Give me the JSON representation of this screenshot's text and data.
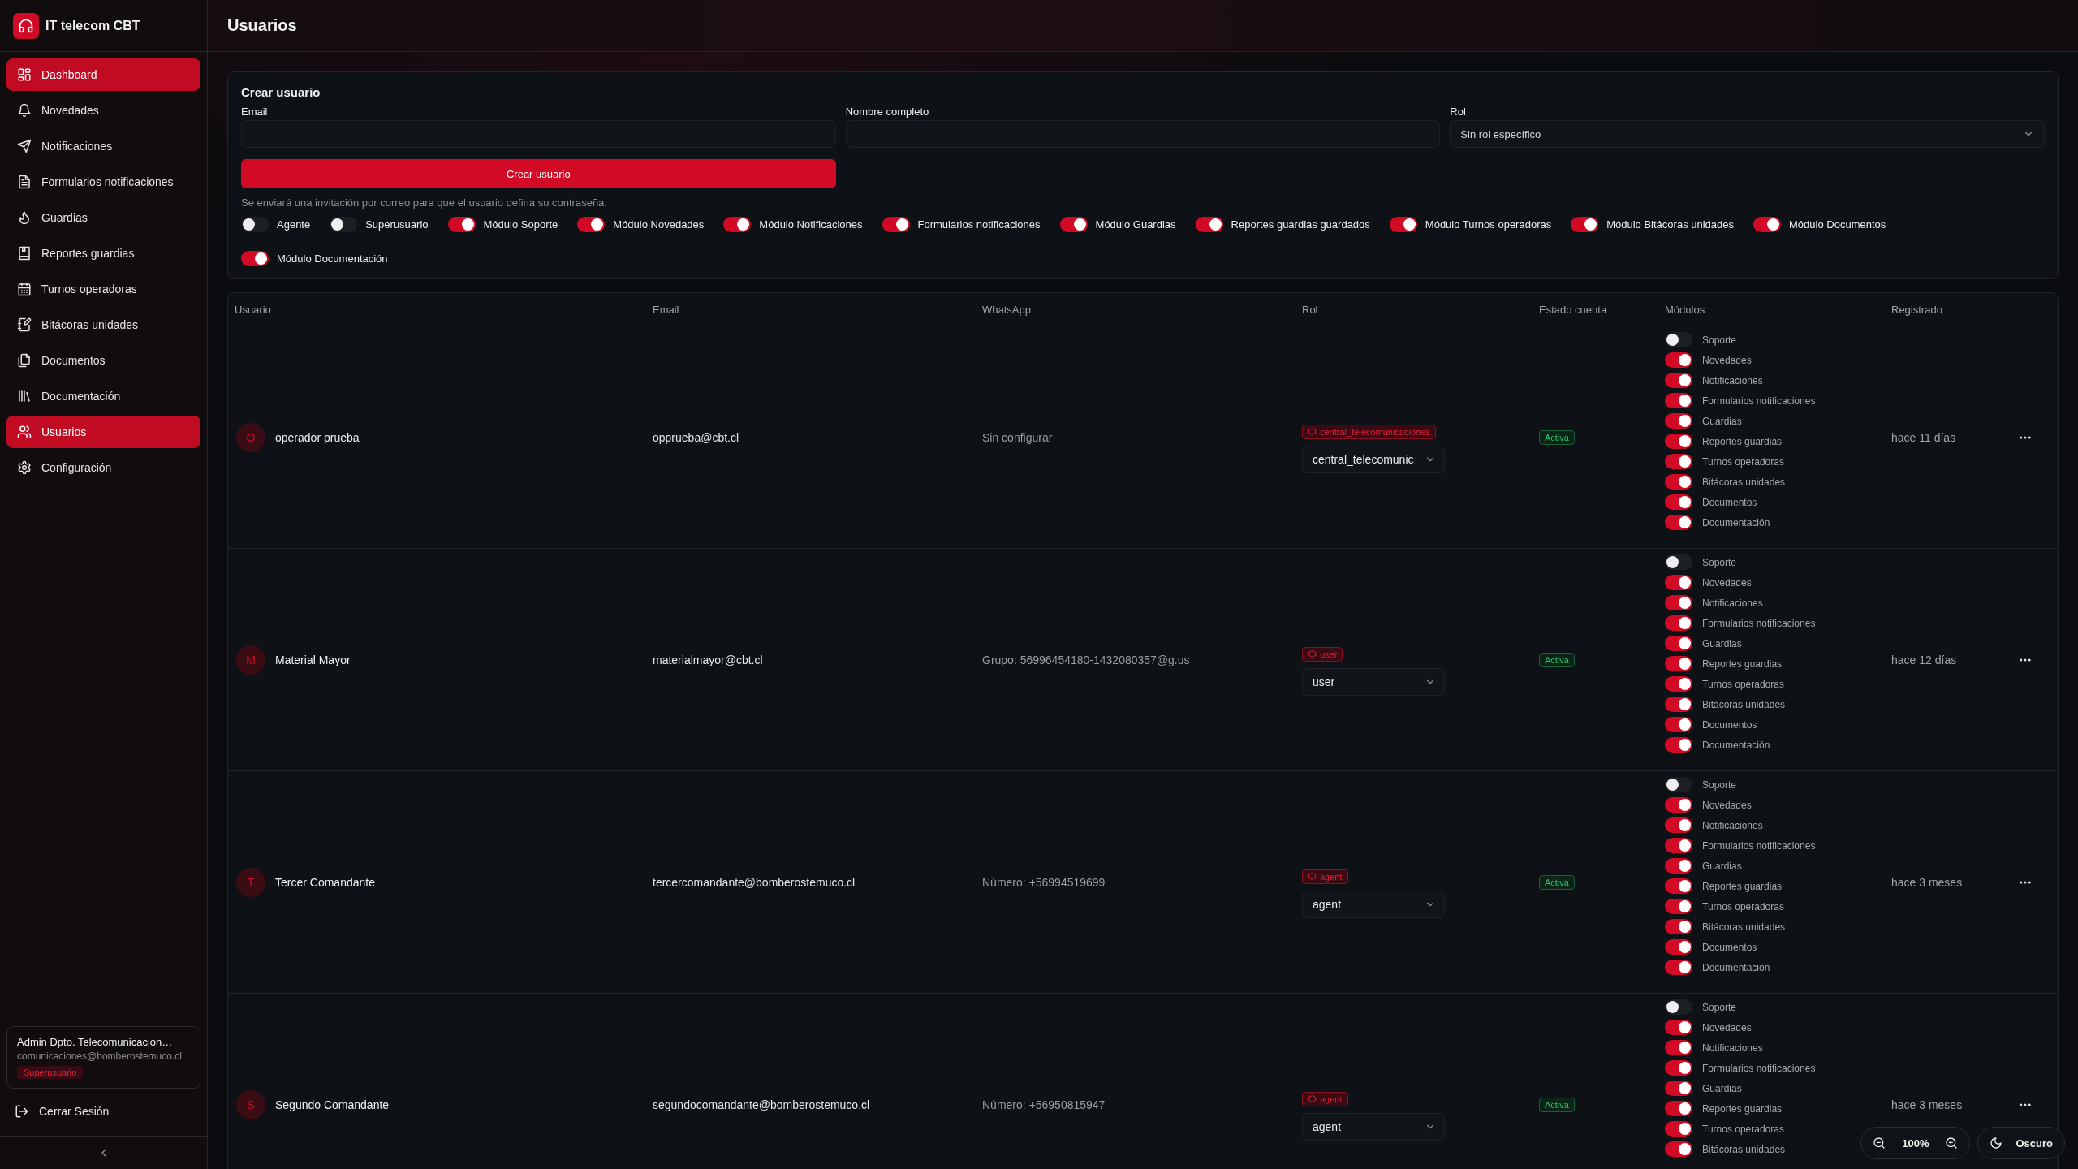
{
  "sidebar": {
    "brand": "IT telecom CBT",
    "items": [
      {
        "label": "Dashboard",
        "selected": true
      },
      {
        "label": "Novedades",
        "selected": false
      },
      {
        "label": "Notificaciones",
        "selected": false
      },
      {
        "label": "Formularios notificaciones",
        "selected": false
      },
      {
        "label": "Guardias",
        "selected": false
      },
      {
        "label": "Reportes guardias",
        "selected": false
      },
      {
        "label": "Turnos operadoras",
        "selected": false
      },
      {
        "label": "Bitácoras unidades",
        "selected": false
      },
      {
        "label": "Documentos",
        "selected": false
      },
      {
        "label": "Documentación",
        "selected": false
      },
      {
        "label": "Usuarios",
        "selected": true
      },
      {
        "label": "Configuración",
        "selected": false
      }
    ],
    "user": {
      "name": "Admin Dpto. Telecomunicacion…",
      "email": "comunicaciones@bomberostemuco.cl",
      "badge": "Superusuario"
    },
    "logout": "Cerrar Sesión"
  },
  "header": {
    "title": "Usuarios"
  },
  "create_form": {
    "title": "Crear usuario",
    "fields": [
      {
        "label": "Email",
        "kind": "text"
      },
      {
        "label": "Nombre completo",
        "kind": "text"
      },
      {
        "label": "Rol",
        "kind": "select",
        "value": "Sin rol específico"
      }
    ],
    "submit": "Crear usuario",
    "hint": "Se enviará una invitación por correo para que el usuario defina su contraseña.",
    "toggles": [
      {
        "label": "Agente",
        "on": false
      },
      {
        "label": "Superusuario",
        "on": false
      },
      {
        "label": "Módulo Soporte",
        "on": true
      },
      {
        "label": "Módulo Novedades",
        "on": true
      },
      {
        "label": "Módulo Notificaciones",
        "on": true
      },
      {
        "label": "Formularios notificaciones",
        "on": true
      },
      {
        "label": "Módulo Guardias",
        "on": true
      },
      {
        "label": "Reportes guardias guardados",
        "on": true
      },
      {
        "label": "Módulo Turnos operadoras",
        "on": true
      },
      {
        "label": "Módulo Bitácoras unidades",
        "on": true
      },
      {
        "label": "Módulo Documentos",
        "on": true
      },
      {
        "label": "Módulo Documentación",
        "on": true
      }
    ]
  },
  "table": {
    "columns": [
      "Usuario",
      "Email",
      "WhatsApp",
      "Rol",
      "Estado cuenta",
      "Módulos",
      "Registrado"
    ],
    "rows": [
      {
        "initial": "O",
        "name": "operador prueba",
        "email": "opprueba@cbt.cl",
        "whatsapp": "Sin configurar",
        "role_badge": "central_telecomunicaciones",
        "role": "central_telecomunic",
        "status": "Activa",
        "registered": "hace 11 días",
        "modules": [
          {
            "label": "Soporte",
            "on": false
          },
          {
            "label": "Novedades",
            "on": true
          },
          {
            "label": "Notificaciones",
            "on": true
          },
          {
            "label": "Formularios notificaciones",
            "on": true
          },
          {
            "label": "Guardias",
            "on": true
          },
          {
            "label": "Reportes guardias",
            "on": true
          },
          {
            "label": "Turnos operadoras",
            "on": true
          },
          {
            "label": "Bitácoras unidades",
            "on": true
          },
          {
            "label": "Documentos",
            "on": true
          },
          {
            "label": "Documentación",
            "on": true
          }
        ]
      },
      {
        "initial": "M",
        "name": "Material Mayor",
        "email": "materialmayor@cbt.cl",
        "whatsapp": "Grupo: 56996454180-1432080357@g.us",
        "role_badge": "user",
        "role": "user",
        "status": "Activa",
        "registered": "hace 12 días",
        "modules": [
          {
            "label": "Soporte",
            "on": false
          },
          {
            "label": "Novedades",
            "on": true
          },
          {
            "label": "Notificaciones",
            "on": true
          },
          {
            "label": "Formularios notificaciones",
            "on": true
          },
          {
            "label": "Guardias",
            "on": true
          },
          {
            "label": "Reportes guardias",
            "on": true
          },
          {
            "label": "Turnos operadoras",
            "on": true
          },
          {
            "label": "Bitácoras unidades",
            "on": true
          },
          {
            "label": "Documentos",
            "on": true
          },
          {
            "label": "Documentación",
            "on": true
          }
        ]
      },
      {
        "initial": "T",
        "name": "Tercer Comandante",
        "email": "tercercomandante@bomberostemuco.cl",
        "whatsapp": "Número: +56994519699",
        "role_badge": "agent",
        "role": "agent",
        "status": "Activa",
        "registered": "hace 3 meses",
        "modules": [
          {
            "label": "Soporte",
            "on": false
          },
          {
            "label": "Novedades",
            "on": true
          },
          {
            "label": "Notificaciones",
            "on": true
          },
          {
            "label": "Formularios notificaciones",
            "on": true
          },
          {
            "label": "Guardias",
            "on": true
          },
          {
            "label": "Reportes guardias",
            "on": true
          },
          {
            "label": "Turnos operadoras",
            "on": true
          },
          {
            "label": "Bitácoras unidades",
            "on": true
          },
          {
            "label": "Documentos",
            "on": true
          },
          {
            "label": "Documentación",
            "on": true
          }
        ]
      },
      {
        "initial": "S",
        "name": "Segundo Comandante",
        "email": "segundocomandante@bomberostemuco.cl",
        "whatsapp": "Número: +56950815947",
        "role_badge": "agent",
        "role": "agent",
        "status": "Activa",
        "registered": "hace 3 meses",
        "modules": [
          {
            "label": "Soporte",
            "on": false
          },
          {
            "label": "Novedades",
            "on": true
          },
          {
            "label": "Notificaciones",
            "on": true
          },
          {
            "label": "Formularios notificaciones",
            "on": true
          },
          {
            "label": "Guardias",
            "on": true
          },
          {
            "label": "Reportes guardias",
            "on": true
          },
          {
            "label": "Turnos operadoras",
            "on": true
          },
          {
            "label": "Bitácoras unidades",
            "on": true
          }
        ]
      }
    ]
  },
  "zoom": {
    "value": "100%"
  },
  "theme": {
    "label": "Oscuro"
  }
}
